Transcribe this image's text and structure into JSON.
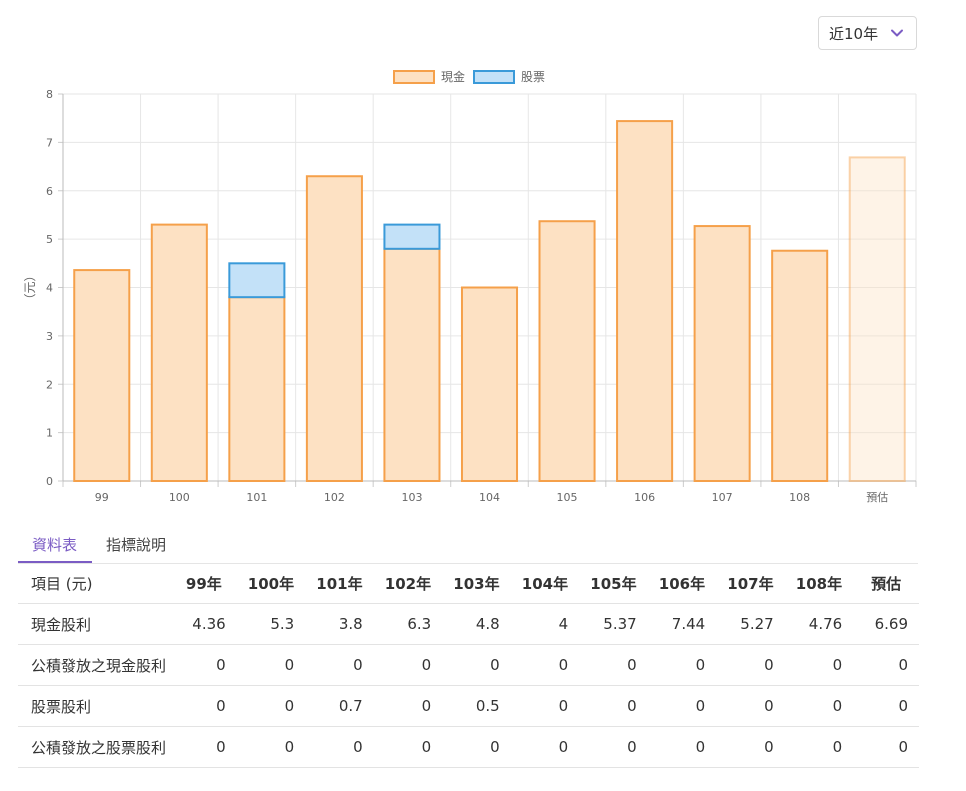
{
  "controls": {
    "range_label": "近10年",
    "accent": "#7b5cc4"
  },
  "tabs": [
    {
      "label": "資料表",
      "active": true
    },
    {
      "label": "指標說明",
      "active": false
    }
  ],
  "chart_data": {
    "type": "bar",
    "stacked": true,
    "categories": [
      "99",
      "100",
      "101",
      "102",
      "103",
      "104",
      "105",
      "106",
      "107",
      "108",
      "預估"
    ],
    "series": [
      {
        "name": "現金",
        "values": [
          4.36,
          5.3,
          3.8,
          6.3,
          4.8,
          4,
          5.37,
          7.44,
          5.27,
          4.76,
          6.69
        ],
        "fill": "#fde1c3",
        "stroke": "#f5a04a"
      },
      {
        "name": "股票",
        "values": [
          0,
          0,
          0.7,
          0,
          0.5,
          0,
          0,
          0,
          0,
          0,
          0
        ],
        "fill": "#c3e1f8",
        "stroke": "#3a9ad9"
      }
    ],
    "estimate_category": "預估",
    "ylabel": "（元）",
    "ylim": [
      0,
      8
    ],
    "yticks": [
      "0",
      "1",
      "2",
      "3",
      "4",
      "5",
      "6",
      "7",
      "8"
    ],
    "grid": true,
    "legend_position": "top-center"
  },
  "table": {
    "headers": [
      "項目 (元)",
      "99年",
      "100年",
      "101年",
      "102年",
      "103年",
      "104年",
      "105年",
      "106年",
      "107年",
      "108年",
      "預估"
    ],
    "rows": [
      {
        "label": "現金股利",
        "values": [
          "4.36",
          "5.3",
          "3.8",
          "6.3",
          "4.8",
          "4",
          "5.37",
          "7.44",
          "5.27",
          "4.76",
          "6.69"
        ]
      },
      {
        "label": "公積發放之現金股利",
        "values": [
          "0",
          "0",
          "0",
          "0",
          "0",
          "0",
          "0",
          "0",
          "0",
          "0",
          "0"
        ]
      },
      {
        "label": "股票股利",
        "values": [
          "0",
          "0",
          "0.7",
          "0",
          "0.5",
          "0",
          "0",
          "0",
          "0",
          "0",
          "0"
        ]
      },
      {
        "label": "公積發放之股票股利",
        "values": [
          "0",
          "0",
          "0",
          "0",
          "0",
          "0",
          "0",
          "0",
          "0",
          "0",
          "0"
        ]
      }
    ]
  }
}
